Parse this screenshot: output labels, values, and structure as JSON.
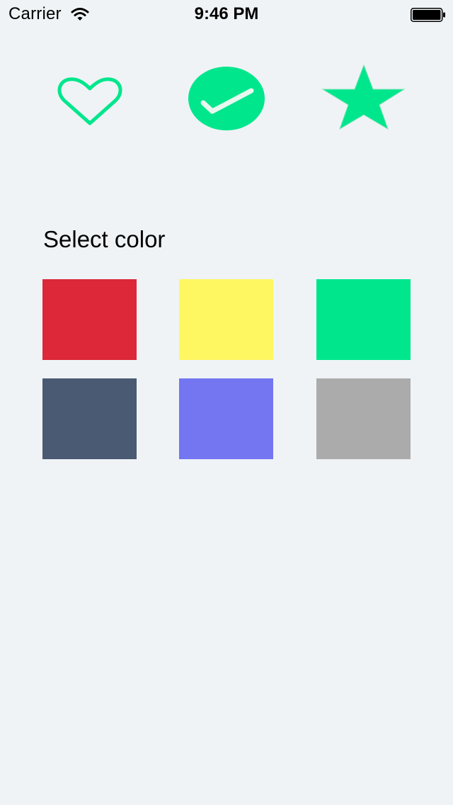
{
  "status_bar": {
    "carrier": "Carrier",
    "time": "9:46 PM",
    "wifi_icon": "wifi-icon",
    "battery_icon": "battery-full-icon"
  },
  "toolbar": {
    "icons": [
      {
        "name": "heart-icon",
        "style": "outline",
        "color": "#00e68c"
      },
      {
        "name": "checkmark-circle-icon",
        "style": "filled",
        "color": "#00e68c"
      },
      {
        "name": "star-icon",
        "style": "filled",
        "color": "#00e68c"
      }
    ]
  },
  "color_picker": {
    "title": "Select color",
    "colors": [
      "#dc2839",
      "#fff761",
      "#00e68c",
      "#4a5a73",
      "#7375f1",
      "#ababab"
    ]
  }
}
